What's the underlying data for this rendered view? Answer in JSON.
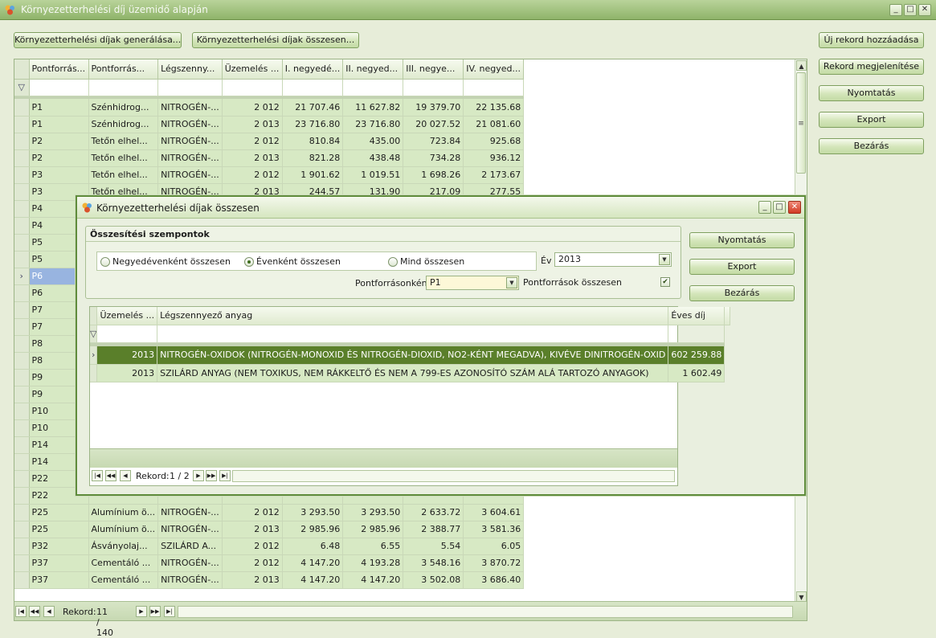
{
  "window": {
    "title": "Környezetterhelési díj üzemidő alapján"
  },
  "toolbar": {
    "generate_label": "Környezetterhelési díjak generálása...",
    "summary_label": "Környezetterhelési díjak összesen..."
  },
  "side_buttons": {
    "new_record": "Új rekord hozzáadása",
    "show_record": "Rekord megjelenítése",
    "print": "Nyomtatás",
    "export": "Export",
    "close": "Bezárás"
  },
  "main_grid": {
    "columns": [
      "Pontforrás...",
      "Pontforrás...",
      "Légszenny...",
      "Üzemelés ...",
      "I. negyedé...",
      "II. negyed...",
      "III. negye...",
      "IV. negyed..."
    ],
    "rows": [
      [
        "P1",
        "Szénhidrog...",
        "NITROGÉN-...",
        "2 012",
        "21 707.46",
        "11 627.82",
        "19 379.70",
        "22 135.68"
      ],
      [
        "P1",
        "Szénhidrog...",
        "NITROGÉN-...",
        "2 013",
        "23 716.80",
        "23 716.80",
        "20 027.52",
        "21 081.60"
      ],
      [
        "P2",
        "Tetőn elhel...",
        "NITROGÉN-...",
        "2 012",
        "810.84",
        "435.00",
        "723.84",
        "925.68"
      ],
      [
        "P2",
        "Tetőn elhel...",
        "NITROGÉN-...",
        "2 013",
        "821.28",
        "438.48",
        "734.28",
        "936.12"
      ],
      [
        "P3",
        "Tetőn elhel...",
        "NITROGÉN-...",
        "2 012",
        "1 901.62",
        "1 019.51",
        "1 698.26",
        "2 173.67"
      ],
      [
        "P3",
        "Tetőn elhel...",
        "NITROGÉN-...",
        "2 013",
        "244.57",
        "131.90",
        "217.09",
        "277.55"
      ],
      [
        "P4",
        "",
        "",
        "",
        "",
        "",
        "",
        ""
      ],
      [
        "P4",
        "",
        "",
        "",
        "",
        "",
        "",
        ""
      ],
      [
        "P5",
        "",
        "",
        "",
        "",
        "",
        "",
        ""
      ],
      [
        "P5",
        "",
        "",
        "",
        "",
        "",
        "",
        ""
      ],
      [
        "P6",
        "",
        "",
        "",
        "",
        "",
        "",
        ""
      ],
      [
        "P6",
        "",
        "",
        "",
        "",
        "",
        "",
        ""
      ],
      [
        "P7",
        "",
        "",
        "",
        "",
        "",
        "",
        ""
      ],
      [
        "P7",
        "",
        "",
        "",
        "",
        "",
        "",
        ""
      ],
      [
        "P8",
        "",
        "",
        "",
        "",
        "",
        "",
        ""
      ],
      [
        "P8",
        "",
        "",
        "",
        "",
        "",
        "",
        ""
      ],
      [
        "P9",
        "",
        "",
        "",
        "",
        "",
        "",
        ""
      ],
      [
        "P9",
        "",
        "",
        "",
        "",
        "",
        "",
        ""
      ],
      [
        "P10",
        "",
        "",
        "",
        "",
        "",
        "",
        ""
      ],
      [
        "P10",
        "",
        "",
        "",
        "",
        "",
        "",
        ""
      ],
      [
        "P14",
        "",
        "",
        "",
        "",
        "",
        "",
        ""
      ],
      [
        "P14",
        "",
        "",
        "",
        "",
        "",
        "",
        ""
      ],
      [
        "P22",
        "",
        "",
        "",
        "",
        "",
        "",
        ""
      ],
      [
        "P22",
        "",
        "",
        "",
        "",
        "",
        "",
        ""
      ],
      [
        "P25",
        "Alumínium ö...",
        "NITROGÉN-...",
        "2 012",
        "3 293.50",
        "3 293.50",
        "2 633.72",
        "3 604.61"
      ],
      [
        "P25",
        "Alumínium ö...",
        "NITROGÉN-...",
        "2 013",
        "2 985.96",
        "2 985.96",
        "2 388.77",
        "3 581.36"
      ],
      [
        "P32",
        "Ásványolaj...",
        "SZILÁRD A...",
        "2 012",
        "6.48",
        "6.55",
        "5.54",
        "6.05"
      ],
      [
        "P37",
        "Cementáló ...",
        "NITROGÉN-...",
        "2 012",
        "4 147.20",
        "4 193.28",
        "3 548.16",
        "3 870.72"
      ],
      [
        "P37",
        "Cementáló ...",
        "NITROGÉN-...",
        "2 013",
        "4 147.20",
        "4 147.20",
        "3 502.08",
        "3 686.40"
      ]
    ],
    "selected_row_marker": "›",
    "filter_icon": "▽",
    "navigator": {
      "label": "Rekord:",
      "position": "11 / 140"
    }
  },
  "dialog": {
    "title": "Környezetterhelési díjak összesen",
    "group_title": "Összesítési szempontok",
    "radios": {
      "quarterly": "Negyedévenként összesen",
      "yearly": "Évenként összesen",
      "all": "Mind összesen"
    },
    "selected_radio": "yearly",
    "year_label": "Év",
    "year_value": "2013",
    "source_label": "Pontforrásonként",
    "source_value": "P1",
    "sources_total_label": "Pontforrások összesen",
    "sources_total_checked": true,
    "buttons": {
      "print": "Nyomtatás",
      "export": "Export",
      "close": "Bezárás"
    },
    "grid": {
      "columns": [
        "Üzemelés ...",
        "Légszennyező anyag",
        "Éves díj"
      ],
      "rows": [
        [
          "2013",
          "NITROGÉN-OXIDOK (NITROGÉN-MONOXID ÉS NITROGÉN-DIOXID, NO2-KÉNT MEGADVA), KIVÉVE DINITROGÉN-OXID",
          "602 259.88"
        ],
        [
          "2013",
          "SZILÁRD ANYAG (NEM TOXIKUS, NEM RÁKKELTŐ ÉS NEM A 799-ES AZONOSÍTÓ SZÁM ALÁ TARTOZÓ ANYAGOK)",
          "1 602.49"
        ]
      ],
      "navigator": {
        "label": "Rekord:",
        "position": "1 / 2"
      }
    }
  },
  "colors": {
    "accent": "#5a7f2a",
    "row_bg": "#d7e9c4",
    "selected_cell": "#98b4e0"
  }
}
